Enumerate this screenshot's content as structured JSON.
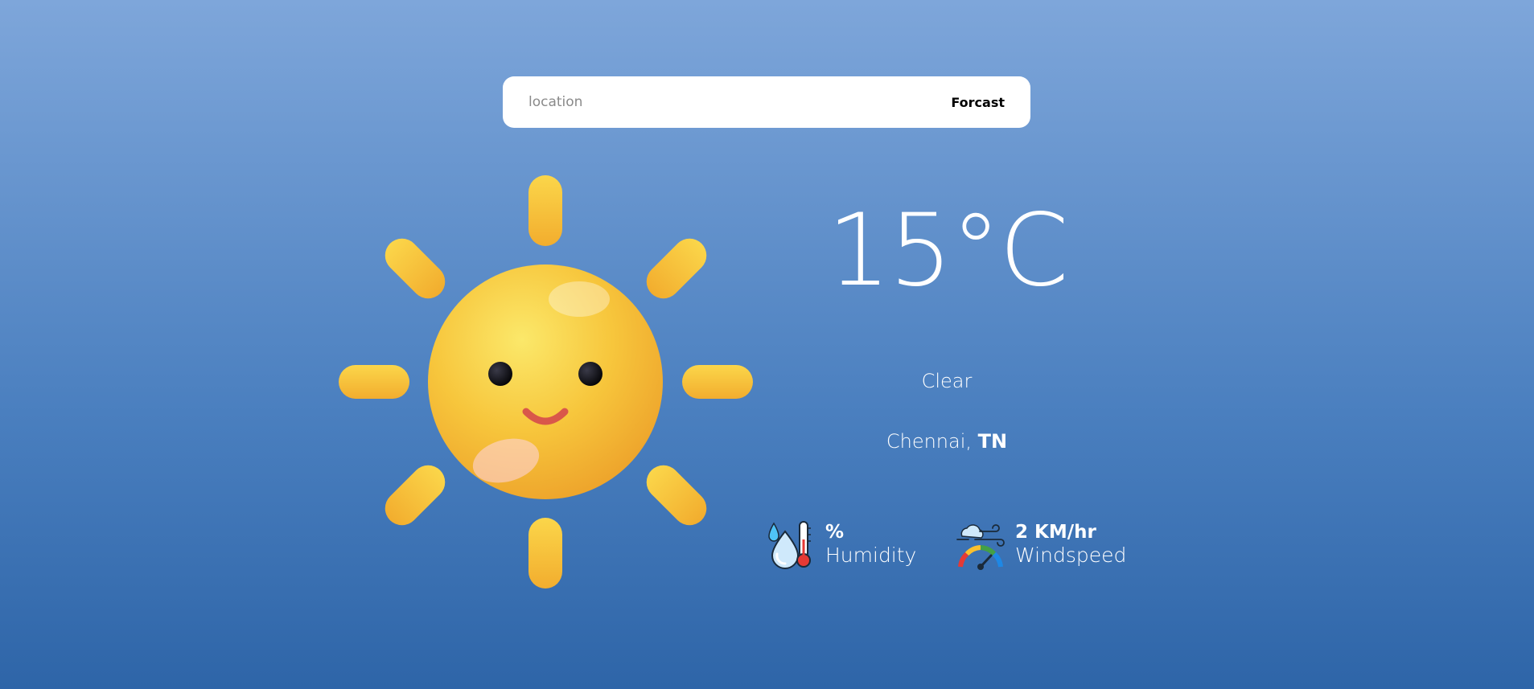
{
  "search": {
    "placeholder": "location",
    "button_label": "Forcast"
  },
  "weather": {
    "temperature": "15°C",
    "condition": "Clear",
    "city": "Chennai, ",
    "state": "TN",
    "humidity_value": "%",
    "humidity_label": "Humidity",
    "wind_value": "2 KM/hr",
    "wind_label": "Windspeed"
  },
  "icons": {
    "weather_icon": "sun-icon",
    "humidity_icon": "humidity-icon",
    "wind_icon": "wind-speed-icon"
  },
  "colors": {
    "background_top": "#7ea6da",
    "background_bottom": "#2e65a8",
    "sun": "#f6c23a",
    "text": "#ffffff"
  }
}
